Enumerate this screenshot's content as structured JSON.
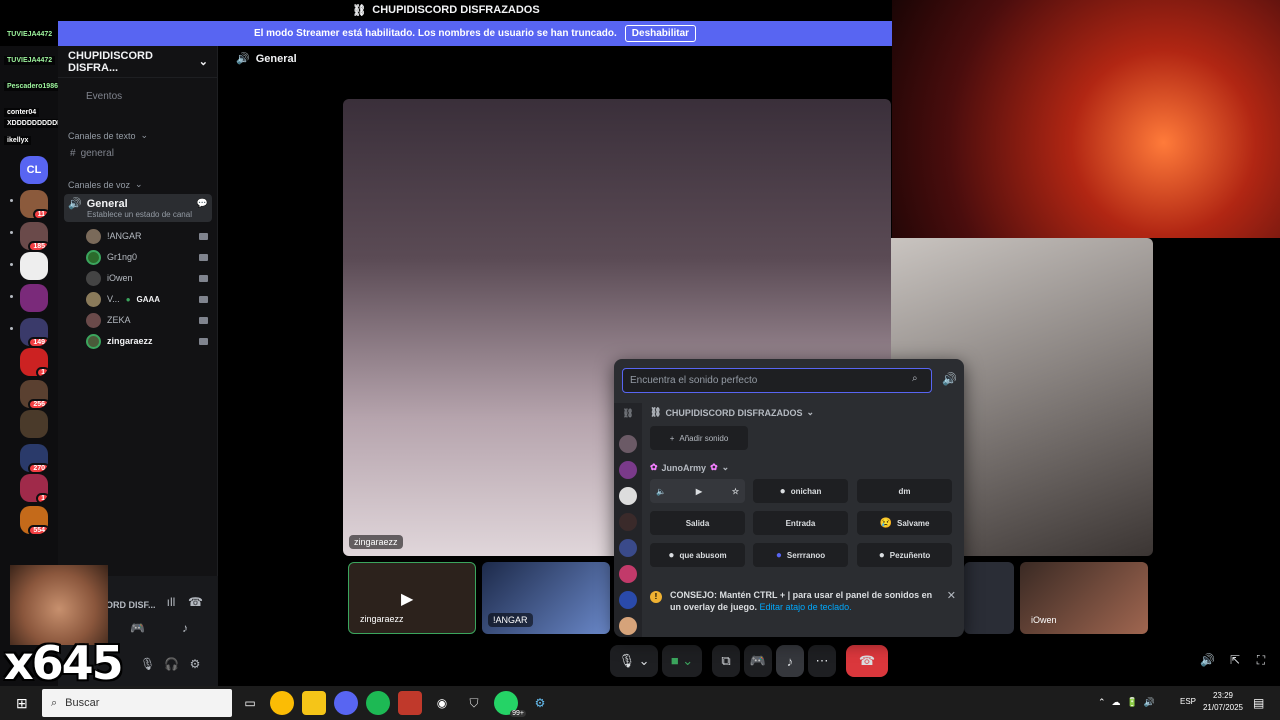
{
  "window": {
    "title": "CHUPIDISCORD DISFRAZADOS"
  },
  "streamer_banner": {
    "text": "El modo Streamer está habilitado. Los nombres de usuario se han truncado.",
    "button": "Deshabilitar"
  },
  "stream_overlay": {
    "chat_names": [
      "TUVIEJA4472",
      "TUVIEJA4472",
      "Pescadero1986",
      "conter04",
      "XDDDDDDDDDDD",
      "ikellyx"
    ],
    "counter": "x645"
  },
  "server_rail": {
    "home_label": "CL",
    "badges": [
      "11",
      "185",
      "149",
      "1",
      "256",
      "270",
      "1",
      "554"
    ]
  },
  "sidebar": {
    "server_name": "CHUPIDISCORD DISFRA...",
    "events_label": "Eventos",
    "text_category": "Canales de texto",
    "text_channel": "general",
    "voice_category": "Canales de voz",
    "voice_channel": {
      "name": "General",
      "status": "Establece un estado de canal"
    },
    "voice_users": [
      {
        "name": "!ANGAR",
        "tag": ""
      },
      {
        "name": "Gr1ng0",
        "tag": ""
      },
      {
        "name": "iOwen",
        "tag": ""
      },
      {
        "name": "V...",
        "tag": "GAAA"
      },
      {
        "name": "ZEKA",
        "tag": ""
      },
      {
        "name": "zingaraezz",
        "tag": ""
      }
    ],
    "user_panel": {
      "voice_status": "ORD DISF..."
    }
  },
  "main": {
    "channel_title": "General",
    "main_tile_label": "zingaraezz",
    "thumbnails": [
      {
        "label": "zingaraezz"
      },
      {
        "label": "!ANGAR"
      },
      {
        "label": ""
      },
      {
        "label": "iOwen"
      }
    ]
  },
  "soundboard": {
    "search_placeholder": "Encuentra el sonido perfecto",
    "server_category": "CHUPIDISCORD DISFRAZADOS",
    "add_sound": "Añadir sonido",
    "sub_category": "JunoArmy",
    "sounds": [
      {
        "label": "",
        "emoji": ""
      },
      {
        "label": "onichan",
        "emoji": ""
      },
      {
        "label": "dm",
        "emoji": ""
      },
      {
        "label": "Salida",
        "emoji": ""
      },
      {
        "label": "Entrada",
        "emoji": ""
      },
      {
        "label": "Salvame",
        "emoji": "😢"
      },
      {
        "label": "que abusom",
        "emoji": ""
      },
      {
        "label": "Serrranoo",
        "emoji": ""
      },
      {
        "label": "Pezuñento",
        "emoji": ""
      }
    ],
    "tip_prefix": "CONSEJO: Mantén CTRL + | para usar el panel de sonidos en un overlay de juego.",
    "tip_link": "Editar atajo de teclado."
  },
  "taskbar": {
    "search_placeholder": "Buscar",
    "whatsapp_badge": "99+",
    "language": "ESP",
    "time": "23:29",
    "date": "21/07/2025"
  },
  "colors": {
    "accent": "#5865f2",
    "hangup": "#da373c",
    "online": "#3ba55d",
    "badge": "#f23f43"
  }
}
